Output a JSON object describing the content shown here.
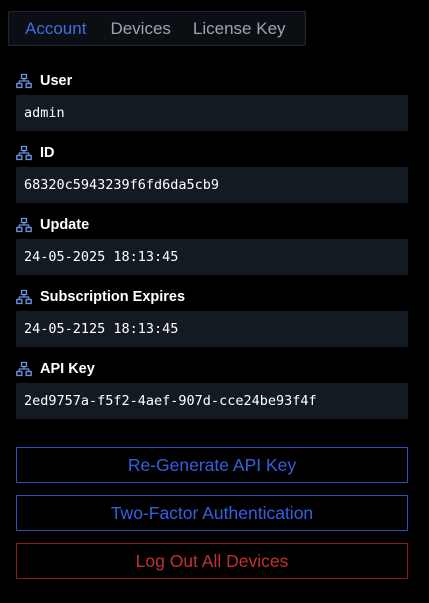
{
  "tabs": {
    "account": "Account",
    "devices": "Devices",
    "license_key": "License Key",
    "active": "account"
  },
  "fields": {
    "user": {
      "label": "User",
      "value": "admin",
      "icon": "network-icon"
    },
    "id": {
      "label": "ID",
      "value": "68320c5943239f6fd6da5cb9",
      "icon": "network-icon"
    },
    "update": {
      "label": "Update",
      "value": "24-05-2025 18:13:45",
      "icon": "network-icon"
    },
    "subscription_expires": {
      "label": "Subscription Expires",
      "value": "24-05-2125 18:13:45",
      "icon": "network-icon"
    },
    "api_key": {
      "label": "API Key",
      "value": "2ed9757a-f5f2-4aef-907d-cce24be93f4f",
      "icon": "network-icon"
    }
  },
  "actions": {
    "regenerate_api_key": "Re-Generate API Key",
    "two_factor_authentication": "Two-Factor Authentication",
    "log_out_all_devices": "Log Out All Devices"
  },
  "colors": {
    "background": "#000000",
    "accent_blue": "#3b6fe0",
    "danger_red": "#c23030",
    "field_background": "#141a21",
    "icon_blue": "#6b93e6"
  }
}
